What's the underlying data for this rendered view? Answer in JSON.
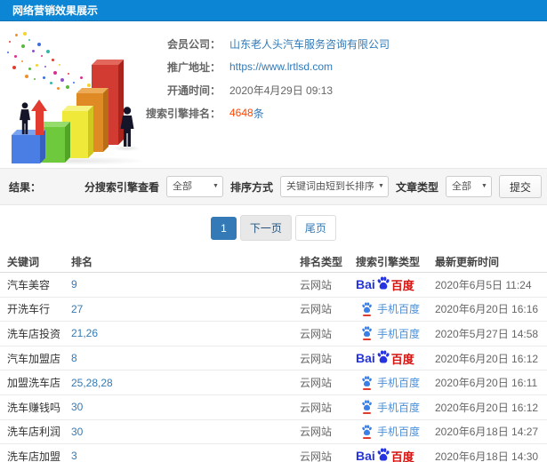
{
  "header": {
    "title": "网络营销效果展示"
  },
  "info": {
    "member": {
      "label": "会员公司：",
      "value": "山东老人头汽车服务咨询有限公司"
    },
    "site": {
      "label": "推广地址：",
      "value": "https://www.lrtlsd.com"
    },
    "opened": {
      "label": "开通时间：",
      "value": "2020年4月29日 09:13"
    },
    "rank": {
      "label": "搜索引擎排名：",
      "count": "4648",
      "unit": "条"
    }
  },
  "filters": {
    "result_label": "结果：",
    "engine": {
      "label": "分搜索引擎查看",
      "value": "全部"
    },
    "sort": {
      "label": "排序方式",
      "value": "关键词由短到长排序"
    },
    "article": {
      "label": "文章类型",
      "value": "全部"
    },
    "submit_label": "提交"
  },
  "pagination": {
    "current": "1",
    "next_label": "下一页",
    "last_label": "尾页"
  },
  "table": {
    "headers": [
      "关键词",
      "排名",
      "排名类型",
      "搜索引擎类型",
      "最新更新时间"
    ],
    "rows": [
      {
        "keyword": "汽车美容",
        "rank": "9",
        "rank_type": "云网站",
        "engine": "baidu",
        "updated": "2020年6月5日 11:24"
      },
      {
        "keyword": "开洗车行",
        "rank": "27",
        "rank_type": "云网站",
        "engine": "mobile-baidu",
        "updated": "2020年6月20日 16:16"
      },
      {
        "keyword": "洗车店投资",
        "rank": "21,26",
        "rank_type": "云网站",
        "engine": "mobile-baidu",
        "updated": "2020年5月27日 14:58"
      },
      {
        "keyword": "汽车加盟店",
        "rank": "8",
        "rank_type": "云网站",
        "engine": "baidu",
        "updated": "2020年6月20日 16:12"
      },
      {
        "keyword": "加盟洗车店",
        "rank": "25,28,28",
        "rank_type": "云网站",
        "engine": "mobile-baidu",
        "updated": "2020年6月20日 16:11"
      },
      {
        "keyword": "洗车赚钱吗",
        "rank": "30",
        "rank_type": "云网站",
        "engine": "mobile-baidu",
        "updated": "2020年6月20日 16:12"
      },
      {
        "keyword": "洗车店利润",
        "rank": "30",
        "rank_type": "云网站",
        "engine": "mobile-baidu",
        "updated": "2020年6月18日 14:27"
      },
      {
        "keyword": "洗车店加盟",
        "rank": "3",
        "rank_type": "云网站",
        "engine": "baidu",
        "updated": "2020年6月18日 14:30"
      }
    ]
  },
  "logos": {
    "baidu_prefix": "Bai",
    "baidu_suffix": "百度",
    "mobile_baidu_label": "手机百度"
  },
  "colors": {
    "header_blue": "#0c86d4",
    "link_blue": "#337ab7",
    "rank_orange": "#ff4400",
    "baidu_blue": "#2534e0",
    "baidu_red": "#d6120f",
    "mobile_blue": "#4a90d9"
  }
}
